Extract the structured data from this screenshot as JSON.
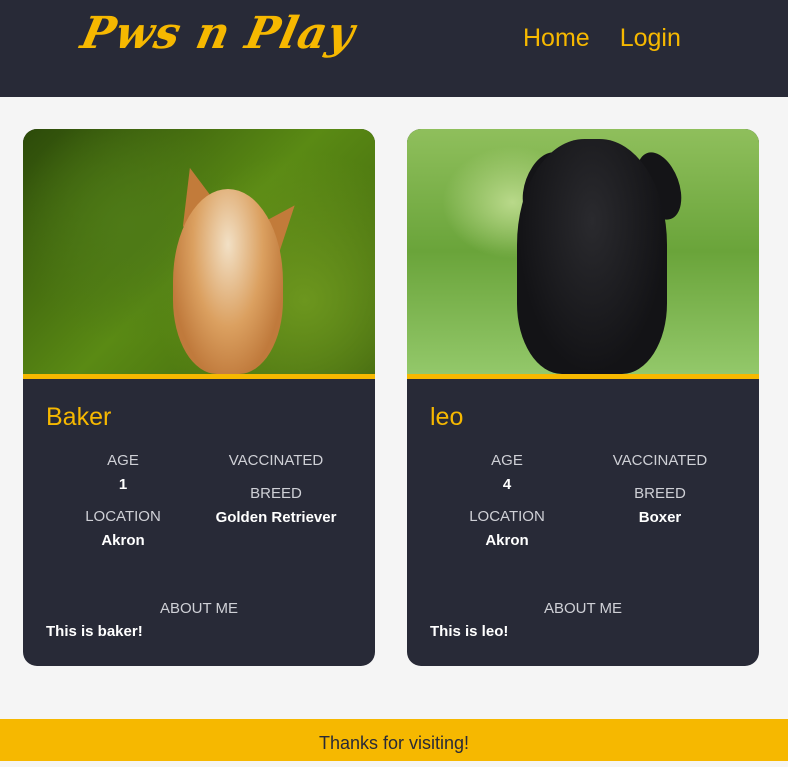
{
  "header": {
    "logo": "Pws n Play",
    "nav": [
      "Home",
      "Login"
    ]
  },
  "labels": {
    "age": "AGE",
    "vaccinated": "VACCINATED",
    "breed": "BREED",
    "location": "LOCATION",
    "about": "ABOUT ME"
  },
  "pets": [
    {
      "name": "Baker",
      "age": "1",
      "breed": "Golden Retriever",
      "location": "Akron",
      "about": "This is baker!"
    },
    {
      "name": "leo",
      "age": "4",
      "breed": "Boxer",
      "location": "Akron",
      "about": "This is leo!"
    }
  ],
  "footer": {
    "text": "Thanks for visiting!"
  },
  "colors": {
    "accent": "#f6b800",
    "dark": "#282a37",
    "background": "#f5f5f5"
  }
}
